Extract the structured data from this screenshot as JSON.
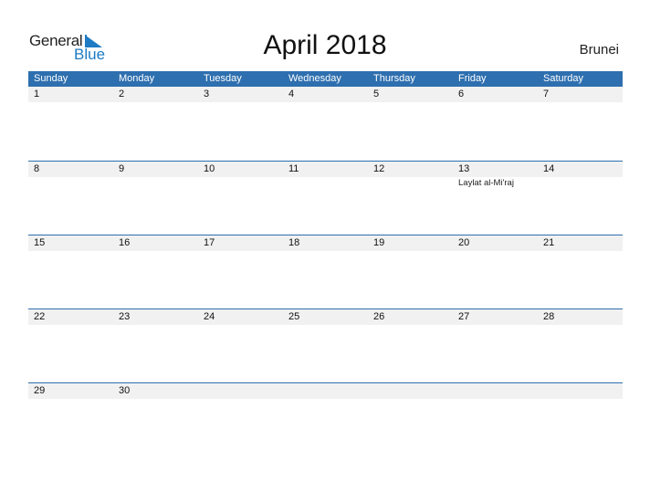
{
  "logo": {
    "part1": "General",
    "part2": "Blue"
  },
  "title": "April 2018",
  "country": "Brunei",
  "colors": {
    "header": "#2e6faf",
    "date_band": "#f1f1f1",
    "logo_blue": "#1e7bc4"
  },
  "weekdays": [
    "Sunday",
    "Monday",
    "Tuesday",
    "Wednesday",
    "Thursday",
    "Friday",
    "Saturday"
  ],
  "weeks": [
    {
      "days": [
        "1",
        "2",
        "3",
        "4",
        "5",
        "6",
        "7"
      ],
      "events": [
        "",
        "",
        "",
        "",
        "",
        "",
        ""
      ]
    },
    {
      "days": [
        "8",
        "9",
        "10",
        "11",
        "12",
        "13",
        "14"
      ],
      "events": [
        "",
        "",
        "",
        "",
        "",
        "Laylat al-Mi'raj",
        ""
      ]
    },
    {
      "days": [
        "15",
        "16",
        "17",
        "18",
        "19",
        "20",
        "21"
      ],
      "events": [
        "",
        "",
        "",
        "",
        "",
        "",
        ""
      ]
    },
    {
      "days": [
        "22",
        "23",
        "24",
        "25",
        "26",
        "27",
        "28"
      ],
      "events": [
        "",
        "",
        "",
        "",
        "",
        "",
        ""
      ]
    },
    {
      "days": [
        "29",
        "30",
        "",
        "",
        "",
        "",
        ""
      ],
      "events": [
        "",
        "",
        "",
        "",
        "",
        "",
        ""
      ]
    }
  ]
}
